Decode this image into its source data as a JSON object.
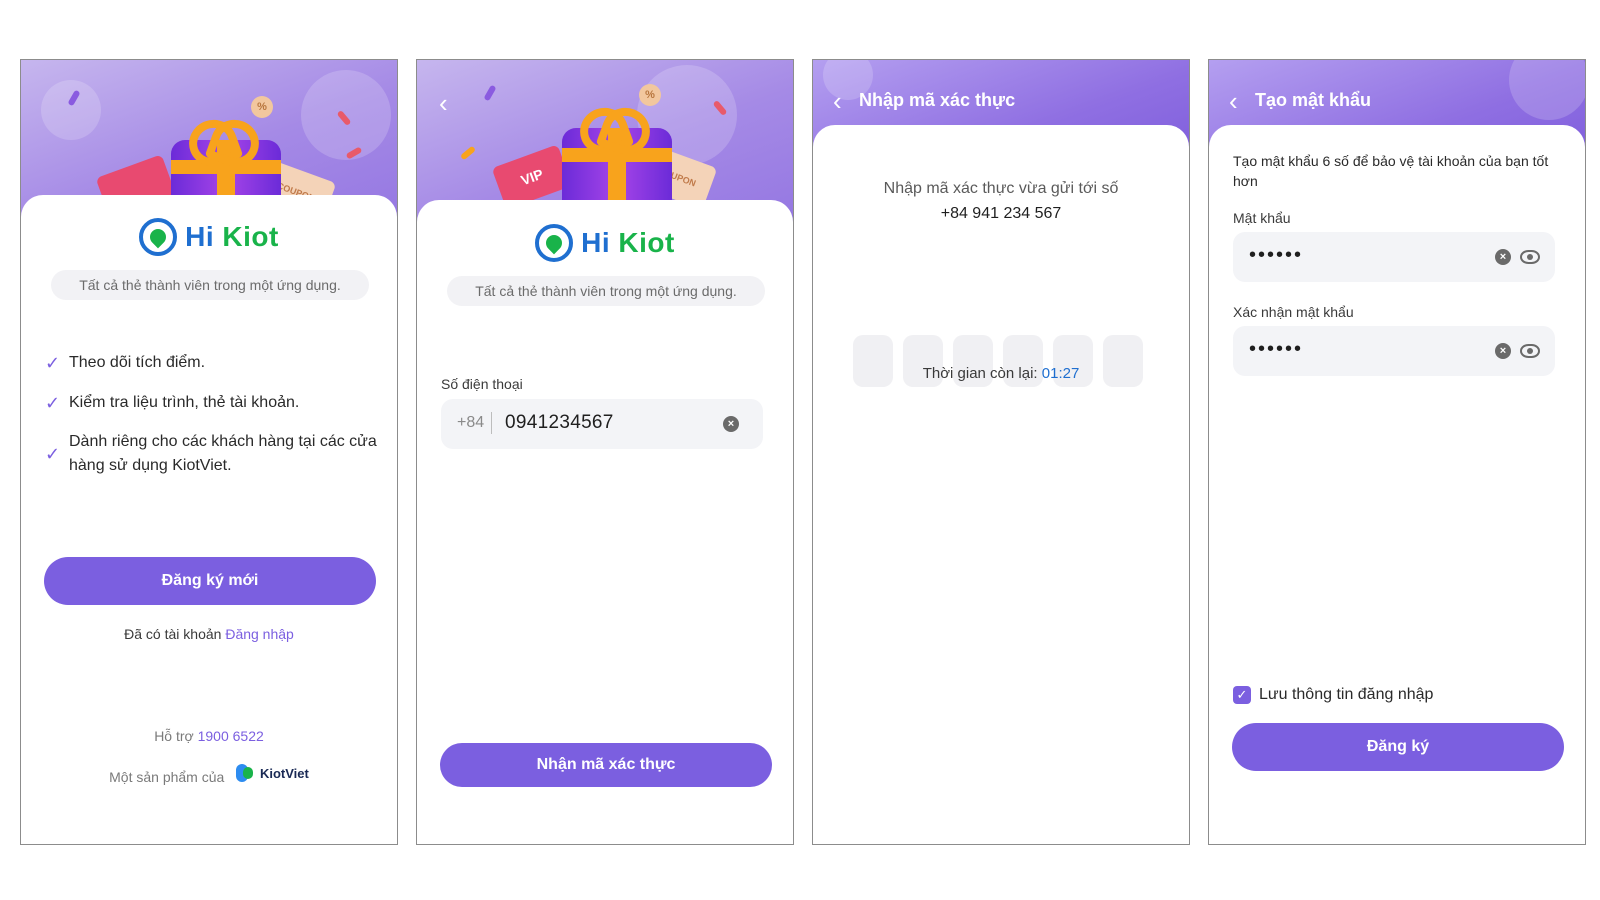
{
  "brand": {
    "hi": "Hi",
    "kiot": "Kiot",
    "tagline": "Tất cả thẻ thành viên trong một ứng dụng."
  },
  "screen1": {
    "features": [
      "Theo dõi tích điểm.",
      "Kiểm tra liệu trình, thẻ tài khoản.",
      "Dành riêng cho các khách hàng tại các cửa hàng sử dụng KiotViet."
    ],
    "register_button": "Đăng ký mới",
    "have_account": "Đã có tài khoản",
    "login_link": "Đăng nhập",
    "support_label": "Hỗ trợ",
    "support_phone": "1900 6522",
    "product_of": "Một sản phẩm của",
    "kiotviet": "KiotViet"
  },
  "screen2": {
    "phone_label": "Số điện thoại",
    "country_code": "+84",
    "phone_value": "0941234567",
    "get_code_button": "Nhận mã xác thực"
  },
  "screen3": {
    "title": "Nhập mã xác thực",
    "instruction": "Nhập mã xác thực vừa gửi tới số",
    "phone": "+84 941 234 567",
    "timer_label": "Thời gian còn lại:",
    "timer_value": "01:27"
  },
  "screen4": {
    "title": "Tạo mật khẩu",
    "instruction": "Tạo mật khẩu 6 số để bảo vệ tài khoản của bạn tốt hơn",
    "password_label": "Mật khẩu",
    "password_value": "••••••",
    "confirm_label": "Xác nhận mật khẩu",
    "confirm_value": "••••••",
    "remember_label": "Lưu thông tin đăng nhập",
    "register_button": "Đăng ký"
  },
  "decor": {
    "coupon": "COUPON",
    "vip": "VIP",
    "percent": "%"
  },
  "colors": {
    "accent": "#7b5fe0",
    "timer": "#1f6fd0",
    "logo_blue": "#1f6fd0",
    "logo_green": "#19b34a"
  }
}
